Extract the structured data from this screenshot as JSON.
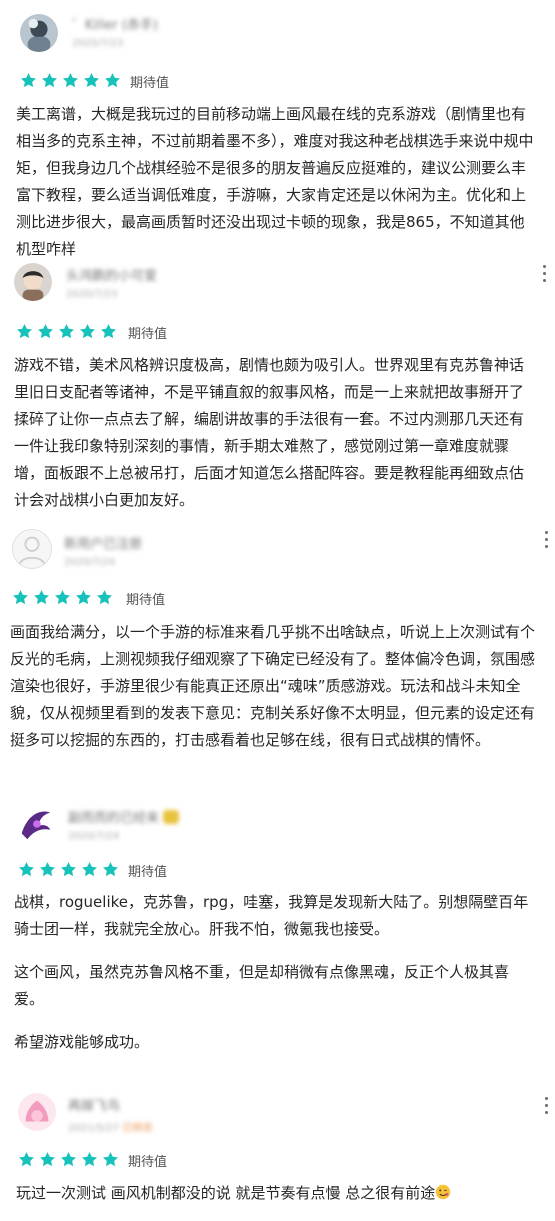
{
  "star_color": "#16c2b9",
  "reviews": [
    {
      "username": "゛Killer (赤手)",
      "date": "2020/7/23",
      "rating": 5,
      "tag": "期待值",
      "paragraphs": [
        "美工离谱，大概是我玩过的目前移动端上画风最在线的克系游戏（剧情里也有相当多的克系主神，不过前期着墨不多），难度对我这种老战棋选手来说中规中矩，但我身边几个战棋经验不是很多的朋友普遍反应挺难的，建议公测要么丰富下教程，要么适当调低难度，手游嘛，大家肯定还是以休闲为主。优化和上测比进步很大，最高画质暂时还没出现过卡顿的现象，我是865，不知道其他机型咋样"
      ]
    },
    {
      "username": "头鸿鹏的小可爱",
      "date": "2020/7/23",
      "rating": 5,
      "tag": "期待值",
      "paragraphs": [
        "游戏不错，美术风格辨识度极高，剧情也颇为吸引人。世界观里有克苏鲁神话里旧日支配者等诸神，不是平铺直叙的叙事风格，而是一上来就把故事掰开了揉碎了让你一点点去了解，编剧讲故事的手法很有一套。不过内测那几天还有一件让我印象特别深刻的事情，新手期太难熬了，感觉刚过第一章难度就骤增，面板跟不上总被吊打，后面才知道怎么搭配阵容。要是教程能再细致点估计会对战棋小白更加友好。"
      ]
    },
    {
      "username": "新用户已注册",
      "date": "2020/7/24",
      "rating": 5,
      "tag": "期待值",
      "paragraphs": [
        "画面我给满分，以一个手游的标准来看几乎挑不出啥缺点，听说上上次测试有个反光的毛病，上测视频我仔细观察了下确定已经没有了。整体偏冷色调，氛围感渲染也很好，手游里很少有能真正还原出“魂味”质感游戏。玩法和战斗未知全貌，仅从视频里看到的发表下意见：克制关系好像不太明显，但元素的设定还有挺多可以挖掘的东西的，打击感看着也足够在线，很有日式战棋的情怀。"
      ]
    },
    {
      "username": "副而而的已经来",
      "date": "2020/7/24",
      "rating": 5,
      "tag": "期待值",
      "paragraphs": [
        "战棋，roguelike，克苏鲁，rpg，哇塞，我算是发现新大陆了。别想隔壁百年骑士团一样，我就完全放心。肝我不怕，微氪我也接受。",
        "这个画风，虽然克苏鲁风格不重，但是却稍微有点像黑魂，反正个人极其喜爱。",
        "希望游戏能够成功。"
      ]
    },
    {
      "username": "再嫁飞鸟",
      "date": "2021/5/27",
      "date_badge": "已修改",
      "rating": 5,
      "tag": "期待值",
      "paragraphs": [
        "玩过一次测试 画风机制都没的说 就是节奏有点慢 总之很有前途"
      ],
      "trailing_emoji": "winking-face-emoji"
    }
  ]
}
